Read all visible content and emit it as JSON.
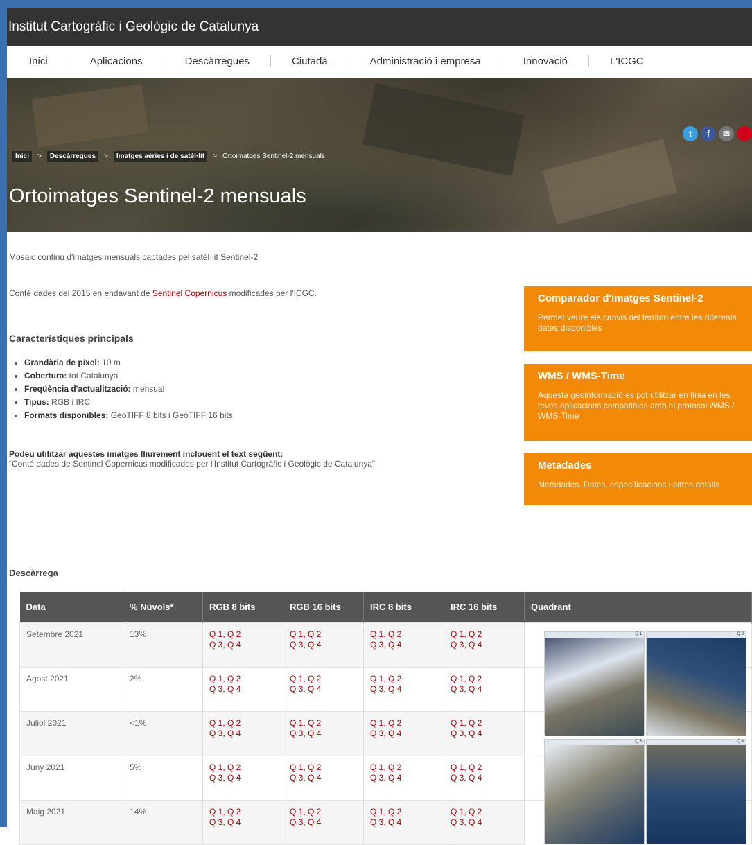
{
  "header": {
    "title": "Institut Cartogràfic i Geològic de Catalunya"
  },
  "nav": [
    "Inici",
    "Aplicacions",
    "Descàrregues",
    "Ciutadà",
    "Administració i empresa",
    "Innovació",
    "L'ICGC"
  ],
  "breadcrumb": {
    "home": "Inici",
    "downloads": "Descàrregues",
    "images": "Imatges aèries i de satèl·lit",
    "current": "Ortoimatges Sentinel-2 mensuals"
  },
  "page": {
    "title": "Ortoimatges Sentinel-2 mensuals",
    "intro": "Mosaic continu d'imatges mensuals captades pel satèl·lit Sentinel-2",
    "intro2_pre": "Conté dades del 2015 en endavant de ",
    "intro2_link": "Sentinel Copernicus",
    "intro2_post": " modificades per l'ICGC."
  },
  "features": {
    "title": "Característiques principals",
    "items": [
      {
        "label": "Grandària de píxel:",
        "value": " 10 m"
      },
      {
        "label": "Cobertura:",
        "value": " tot Catalunya"
      },
      {
        "label": "Freqüència d'actualització:",
        "value": " mensual"
      },
      {
        "label": "Tipus:",
        "value": " RGB i IRC"
      },
      {
        "label": "Formats disponibles:",
        "value": " GeoTIFF 8 bits i GeoTIFF 16 bits"
      }
    ]
  },
  "usage": {
    "heading": "Podeu utilitzar aquestes imatges lliurement inclouent el text següent:",
    "quote": "“Conté dades de Sentinel Copernicus modificades per l'Institut Cartogràfic i Geològic de Catalunya”"
  },
  "sidebar": [
    {
      "title": "Comparador d'imatges Sentinel-2",
      "desc": "Permet veure els canvis del territori entre les diferents dates disponibles"
    },
    {
      "title": "WMS / WMS-Time",
      "desc": "Aquesta geoinformació es pot utilitzar en línia en les teves aplicacions compatibles amb el protocol WMS / WMS-Time"
    },
    {
      "title": "Metadades",
      "desc": "Metadades. Dates, especificacions i altres detalls"
    }
  ],
  "download": {
    "title": "Descàrrega",
    "headers": [
      "Data",
      "% Núvols*",
      "RGB 8 bits",
      "RGB 16 bits",
      "IRC 8 bits",
      "IRC 16 bits",
      "Quadrant"
    ],
    "links": {
      "line1": "Q 1, Q 2",
      "line2": "Q 3, Q 4"
    },
    "rows": [
      {
        "date": "Setembre 2021",
        "clouds": "13%"
      },
      {
        "date": "Agost 2021",
        "clouds": "2%"
      },
      {
        "date": "Juliol 2021",
        "clouds": "<1%"
      },
      {
        "date": "Juny 2021",
        "clouds": "5%"
      },
      {
        "date": "Maig 2021",
        "clouds": "14%"
      }
    ]
  },
  "quadrants": [
    "Q 1",
    "Q 2",
    "Q 3",
    "Q 4"
  ],
  "social": {
    "twitter": "t",
    "facebook": "f",
    "mail": "✉"
  }
}
